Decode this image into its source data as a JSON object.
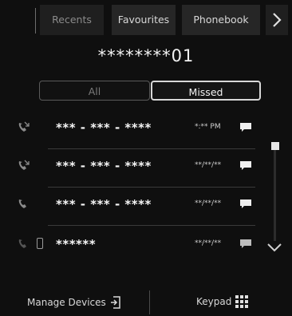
{
  "tabs": [
    {
      "label": "Recents",
      "active": true
    },
    {
      "label": "Favourites",
      "active": false
    },
    {
      "label": "Phonebook",
      "active": false
    }
  ],
  "tab_next_icon": "chevron-right-icon",
  "number": "********01",
  "filters": {
    "all": "All",
    "missed": "Missed",
    "selected": "missed"
  },
  "calls": [
    {
      "name": "*** - *** - ****",
      "time": "*:** PM",
      "icon": "missed-call-icon",
      "has_message": true
    },
    {
      "name": "*** - *** - ****",
      "time": "**/**/**",
      "icon": "missed-call-icon",
      "has_message": true
    },
    {
      "name": "*** - *** - ****",
      "time": "**/**/**",
      "icon": "missed-call-icon",
      "has_message": true
    },
    {
      "name": "******",
      "time": "**/**/**",
      "icon": "missed-call-icon",
      "has_message": true
    }
  ],
  "bottom": {
    "manage_devices": "Manage Devices",
    "keypad": "Keypad"
  },
  "colors": {
    "background": "#0f0f0f",
    "text": "#f2f2f2",
    "muted": "#7a7a7a"
  }
}
